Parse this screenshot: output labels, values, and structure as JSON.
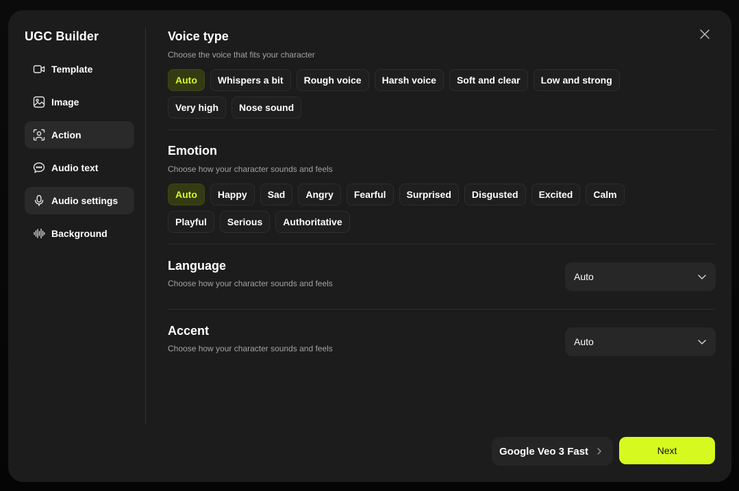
{
  "app": {
    "title": "UGC Builder"
  },
  "sidebar": {
    "items": [
      {
        "label": "Template",
        "icon": "video-icon",
        "active": false
      },
      {
        "label": "Image",
        "icon": "image-icon",
        "active": false
      },
      {
        "label": "Action",
        "icon": "person-icon",
        "active": true
      },
      {
        "label": "Audio text",
        "icon": "chat-icon",
        "active": false
      },
      {
        "label": "Audio settings",
        "icon": "microphone-icon",
        "active": true
      },
      {
        "label": "Background",
        "icon": "waveform-icon",
        "active": false
      }
    ]
  },
  "voice_type": {
    "title": "Voice type",
    "subtitle": "Choose the voice that fits your character",
    "options": [
      "Auto",
      "Whispers a bit",
      "Rough voice",
      "Harsh voice",
      "Soft and clear",
      "Low and strong",
      "Very high",
      "Nose sound"
    ],
    "selected": "Auto"
  },
  "emotion": {
    "title": "Emotion",
    "subtitle": "Choose how your character sounds and feels",
    "options": [
      "Auto",
      "Happy",
      "Sad",
      "Angry",
      "Fearful",
      "Surprised",
      "Disgusted",
      "Excited",
      "Calm",
      "Playful",
      "Serious",
      "Authoritative"
    ],
    "selected": "Auto"
  },
  "language": {
    "title": "Language",
    "subtitle": "Choose how your character sounds and feels",
    "value": "Auto"
  },
  "accent": {
    "title": "Accent",
    "subtitle": "Choose how your character sounds and feels",
    "value": "Auto"
  },
  "footer": {
    "model_label": "Google Veo 3 Fast",
    "next_label": "Next"
  },
  "colors": {
    "accent": "#d6fa1f",
    "modal_bg": "#1c1c1c",
    "chip_selected_bg": "#343b12"
  }
}
